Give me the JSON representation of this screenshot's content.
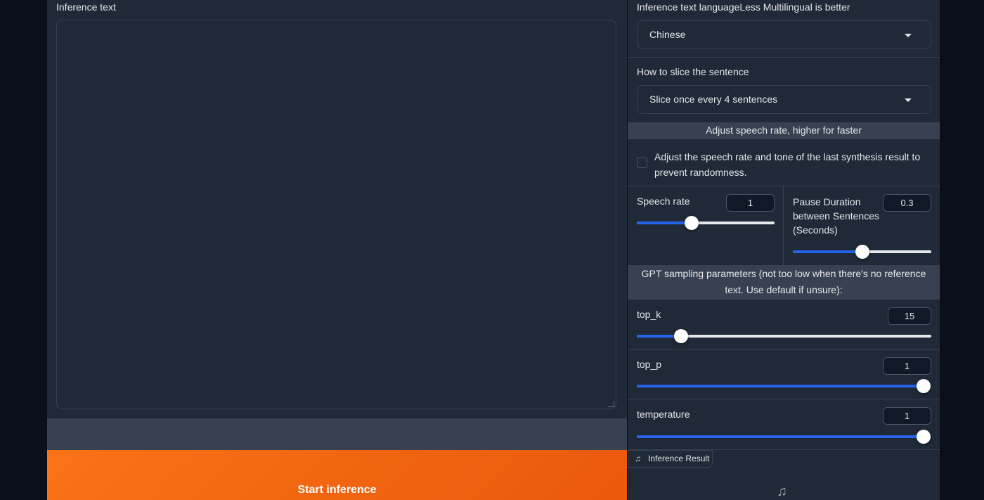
{
  "left": {
    "text_label": "Inference text",
    "text_value": ""
  },
  "right": {
    "language": {
      "label": "Inference text languageLess Multilingual is better",
      "value": "Chinese"
    },
    "slice": {
      "label": "How to slice the sentence",
      "value": "Slice once every 4 sentences"
    },
    "speech_band": "Adjust speech rate, higher for faster",
    "checkbox_label": "Adjust the speech rate and tone of the last synthesis result to prevent randomness.",
    "checkbox_checked": false,
    "speech_rate": {
      "label": "Speech rate",
      "value": "1",
      "fraction": 0.4
    },
    "pause": {
      "label": "Pause Duration between Sentences (Seconds)",
      "value": "0.3",
      "fraction": 0.5
    },
    "gpt_band": "GPT sampling parameters (not too low when there's no reference text. Use default if unsure):",
    "top_k": {
      "label": "top_k",
      "value": "15",
      "fraction": 0.15
    },
    "top_p": {
      "label": "top_p",
      "value": "1",
      "fraction": 1.0
    },
    "temperature": {
      "label": "temperature",
      "value": "1",
      "fraction": 1.0
    }
  },
  "start_button": "Start inference",
  "result": {
    "tab_label": "Inference Result",
    "tab_icon": "music-note-icon",
    "empty_icon": "music-note-icon"
  },
  "colors": {
    "accent": "#2563eb",
    "button": "#f97316",
    "panel": "#1f2937",
    "background": "#0b0f19"
  }
}
